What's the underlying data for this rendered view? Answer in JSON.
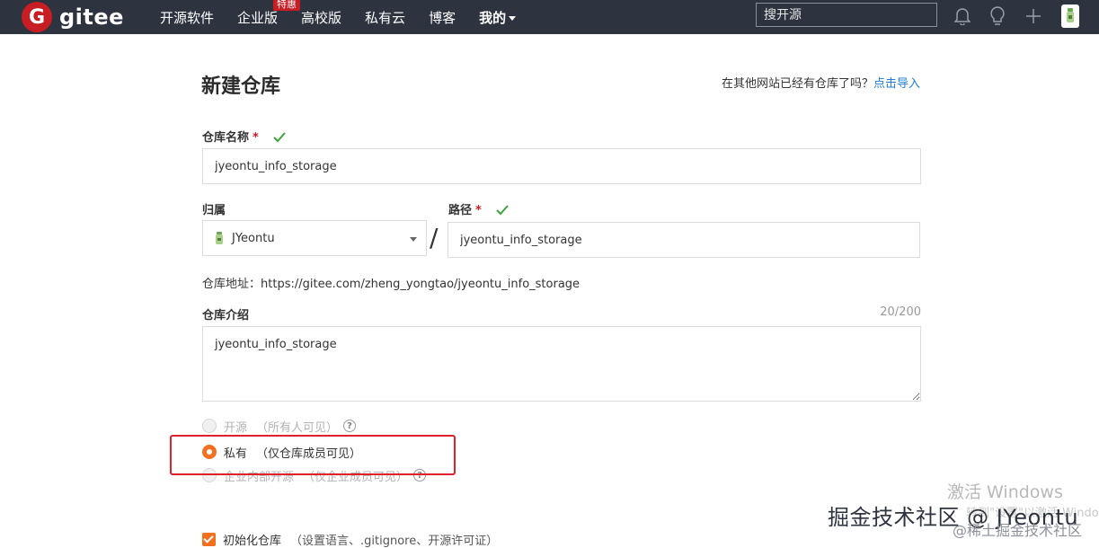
{
  "header": {
    "logo_badge": "G",
    "logo_text": "gitee",
    "nav": [
      {
        "label": "开源软件"
      },
      {
        "label": "企业版",
        "promo": "特惠"
      },
      {
        "label": "高校版"
      },
      {
        "label": "私有云"
      },
      {
        "label": "博客"
      },
      {
        "label": "我的"
      }
    ],
    "search_placeholder": "搜开源",
    "colors": {
      "bar": "#2d333f",
      "brand": "#c71d23"
    }
  },
  "form": {
    "title": "新建仓库",
    "import_prompt": "在其他网站已经有仓库了吗？",
    "import_link": "点击导入",
    "repo_name_label": "仓库名称",
    "required_mark": "*",
    "repo_name_value": "jyeontu_info_storage",
    "owner_label": "归属",
    "owner_value": "JYeontu",
    "separator": "/",
    "path_label": "路径",
    "path_value": "jyeontu_info_storage",
    "url_label": "仓库地址：",
    "url_value": "https://gitee.com/zheng_yongtao/jyeontu_info_storage",
    "desc_label": "仓库介绍",
    "desc_counter": "20/200",
    "desc_value": "jyeontu_info_storage",
    "visibility": [
      {
        "label": "开源",
        "note": "（所有人可见）",
        "help": "?",
        "selected": false,
        "disabled": true
      },
      {
        "label": "私有",
        "note": "（仅仓库成员可见）",
        "selected": true,
        "disabled": false
      },
      {
        "label": "企业内部开源",
        "note": "（仅企业成员可见）",
        "help": "?",
        "selected": false,
        "disabled": true
      }
    ],
    "init_label": "初始化仓库",
    "init_note": "（设置语言、.gitignore、开源许可证）",
    "accent_color": "#f37021"
  },
  "watermarks": {
    "windows": "激活 Windows",
    "windows_sub": "转到\"设置\"以激活 Windows。",
    "main": "掘金技术社区 @ JYeontu",
    "sub": "@稀土掘金技术社区"
  }
}
